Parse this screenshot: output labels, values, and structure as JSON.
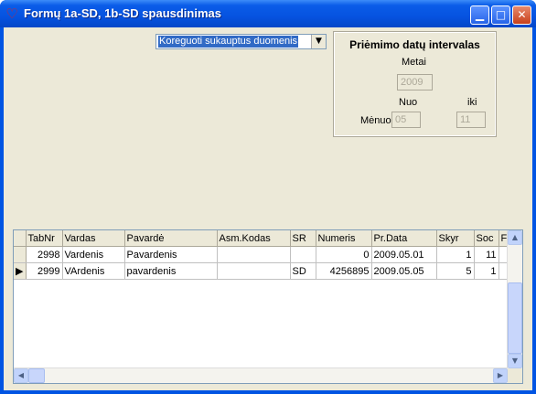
{
  "window": {
    "title": "Formų 1a-SD, 1b-SD spausdinimas"
  },
  "combo": {
    "value": "Koreguoti sukauptus duomenis"
  },
  "panel": {
    "title": "Priėmimo datų intervalas",
    "metai_label": "Metai",
    "metai_value": "2009",
    "nuo_label": "Nuo",
    "iki_label": "iki",
    "menuo_label": "Mėnuo",
    "nuo_value": "05",
    "iki_value": "11"
  },
  "grid": {
    "columns": [
      "TabNr",
      "Vardas",
      "Pavardė",
      "Asm.Kodas",
      "SR",
      "Numeris",
      "Pr.Data",
      "Skyr",
      "Soc",
      "F"
    ],
    "rows": [
      {
        "indicator": "",
        "cells": [
          "2998",
          "Vardenis",
          "Pavardenis",
          "",
          "",
          "0",
          "2009.05.01",
          "1",
          "11",
          ""
        ]
      },
      {
        "indicator": "▶",
        "cells": [
          "2999",
          "VArdenis",
          "pavardenis",
          "",
          "SD",
          "4256895",
          "2009.05.05",
          "5",
          "1",
          ""
        ]
      }
    ]
  }
}
